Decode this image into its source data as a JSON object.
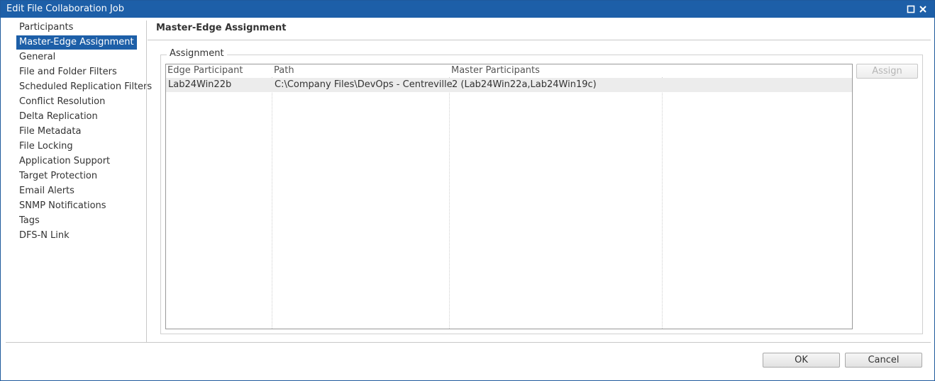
{
  "window": {
    "title": "Edit File Collaboration Job"
  },
  "nav": {
    "items": [
      {
        "label": "Participants",
        "selected": false
      },
      {
        "label": "Master-Edge Assignment",
        "selected": true
      },
      {
        "label": "General",
        "selected": false
      },
      {
        "label": "File and Folder Filters",
        "selected": false
      },
      {
        "label": "Scheduled Replication Filters",
        "selected": false
      },
      {
        "label": "Conflict Resolution",
        "selected": false
      },
      {
        "label": "Delta Replication",
        "selected": false
      },
      {
        "label": "File Metadata",
        "selected": false
      },
      {
        "label": "File Locking",
        "selected": false
      },
      {
        "label": "Application Support",
        "selected": false
      },
      {
        "label": "Target Protection",
        "selected": false
      },
      {
        "label": "Email Alerts",
        "selected": false
      },
      {
        "label": "SNMP Notifications",
        "selected": false
      },
      {
        "label": "Tags",
        "selected": false
      },
      {
        "label": "DFS-N Link",
        "selected": false
      }
    ]
  },
  "panel": {
    "title": "Master-Edge Assignment",
    "group_label": "Assignment",
    "grid": {
      "columns": [
        "Edge Participant",
        "Path",
        "Master Participants",
        ""
      ],
      "rows": [
        [
          "Lab24Win22b",
          "C:\\Company Files\\DevOps - Centreville",
          "2 (Lab24Win22a,Lab24Win19c)",
          ""
        ]
      ]
    },
    "assign_label": "Assign"
  },
  "footer": {
    "ok_label": "OK",
    "cancel_label": "Cancel"
  },
  "colors": {
    "accent": "#1d5fa8"
  }
}
